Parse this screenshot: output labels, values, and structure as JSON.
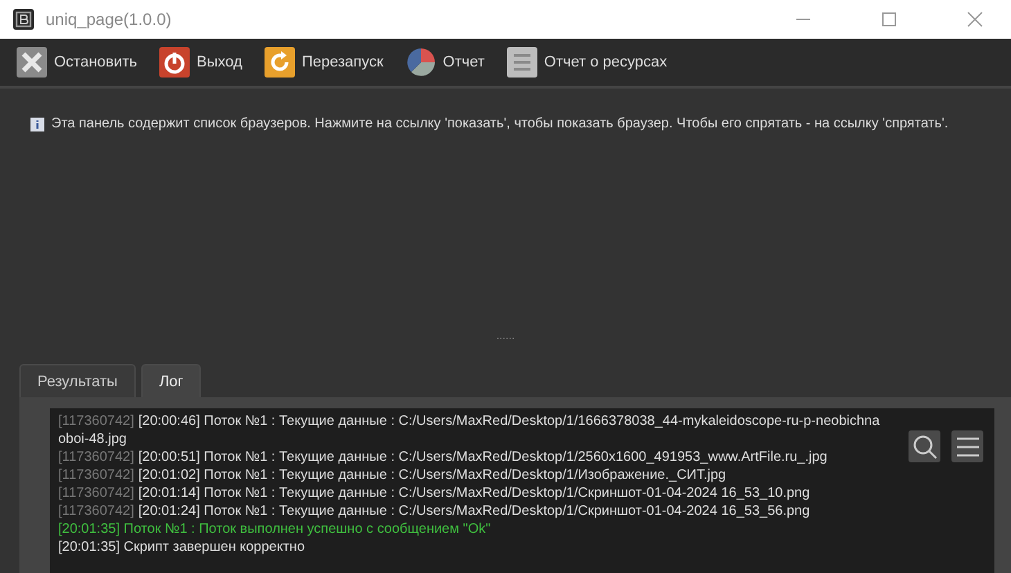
{
  "window": {
    "title": "uniq_page(1.0.0)"
  },
  "toolbar": [
    {
      "kind": "stop",
      "label": "Остановить"
    },
    {
      "kind": "exit",
      "label": "Выход"
    },
    {
      "kind": "restart",
      "label": "Перезапуск"
    },
    {
      "kind": "report",
      "label": "Отчет"
    },
    {
      "kind": "resources",
      "label": "Отчет о ресурсах"
    }
  ],
  "info": {
    "text": "Эта панель содержит список браузеров. Нажмите на ссылку 'показать', чтобы показать браузер. Чтобы его спрятать - на ссылку 'спрятать'."
  },
  "splitter": {
    "label": "......"
  },
  "tabs": [
    {
      "label": "Результаты",
      "selected": false
    },
    {
      "label": "Лог",
      "selected": true
    }
  ],
  "log": [
    {
      "kind": "thread",
      "id": "[117360742]",
      "text": "[20:00:46] Поток №1 : Текущие данные : C:/Users/MaxRed/Desktop/1/1666378038_44-mykaleidoscope-ru-p-neobichna",
      "cont": "oboi-48.jpg"
    },
    {
      "kind": "thread",
      "id": "[117360742]",
      "text": "[20:00:51] Поток №1 : Текущие данные : C:/Users/MaxRed/Desktop/1/2560x1600_491953_www.ArtFile.ru_.jpg"
    },
    {
      "kind": "thread",
      "id": "[117360742]",
      "text": "[20:01:02] Поток №1 : Текущие данные : C:/Users/MaxRed/Desktop/1/Изображение._СИТ.jpg"
    },
    {
      "kind": "thread",
      "id": "[117360742]",
      "text": "[20:01:14] Поток №1 : Текущие данные : C:/Users/MaxRed/Desktop/1/Скриншот-01-04-2024 16_53_10.png"
    },
    {
      "kind": "thread",
      "id": "[117360742]",
      "text": "[20:01:24] Поток №1 : Текущие данные : C:/Users/MaxRed/Desktop/1/Скриншот-01-04-2024 16_53_56.png"
    },
    {
      "kind": "success",
      "text": "[20:01:35] Поток №1 : Поток выполнен успешно с сообщением \"Ok\""
    },
    {
      "kind": "plain",
      "text": "[20:01:35] Скрипт завершен корректно"
    }
  ]
}
